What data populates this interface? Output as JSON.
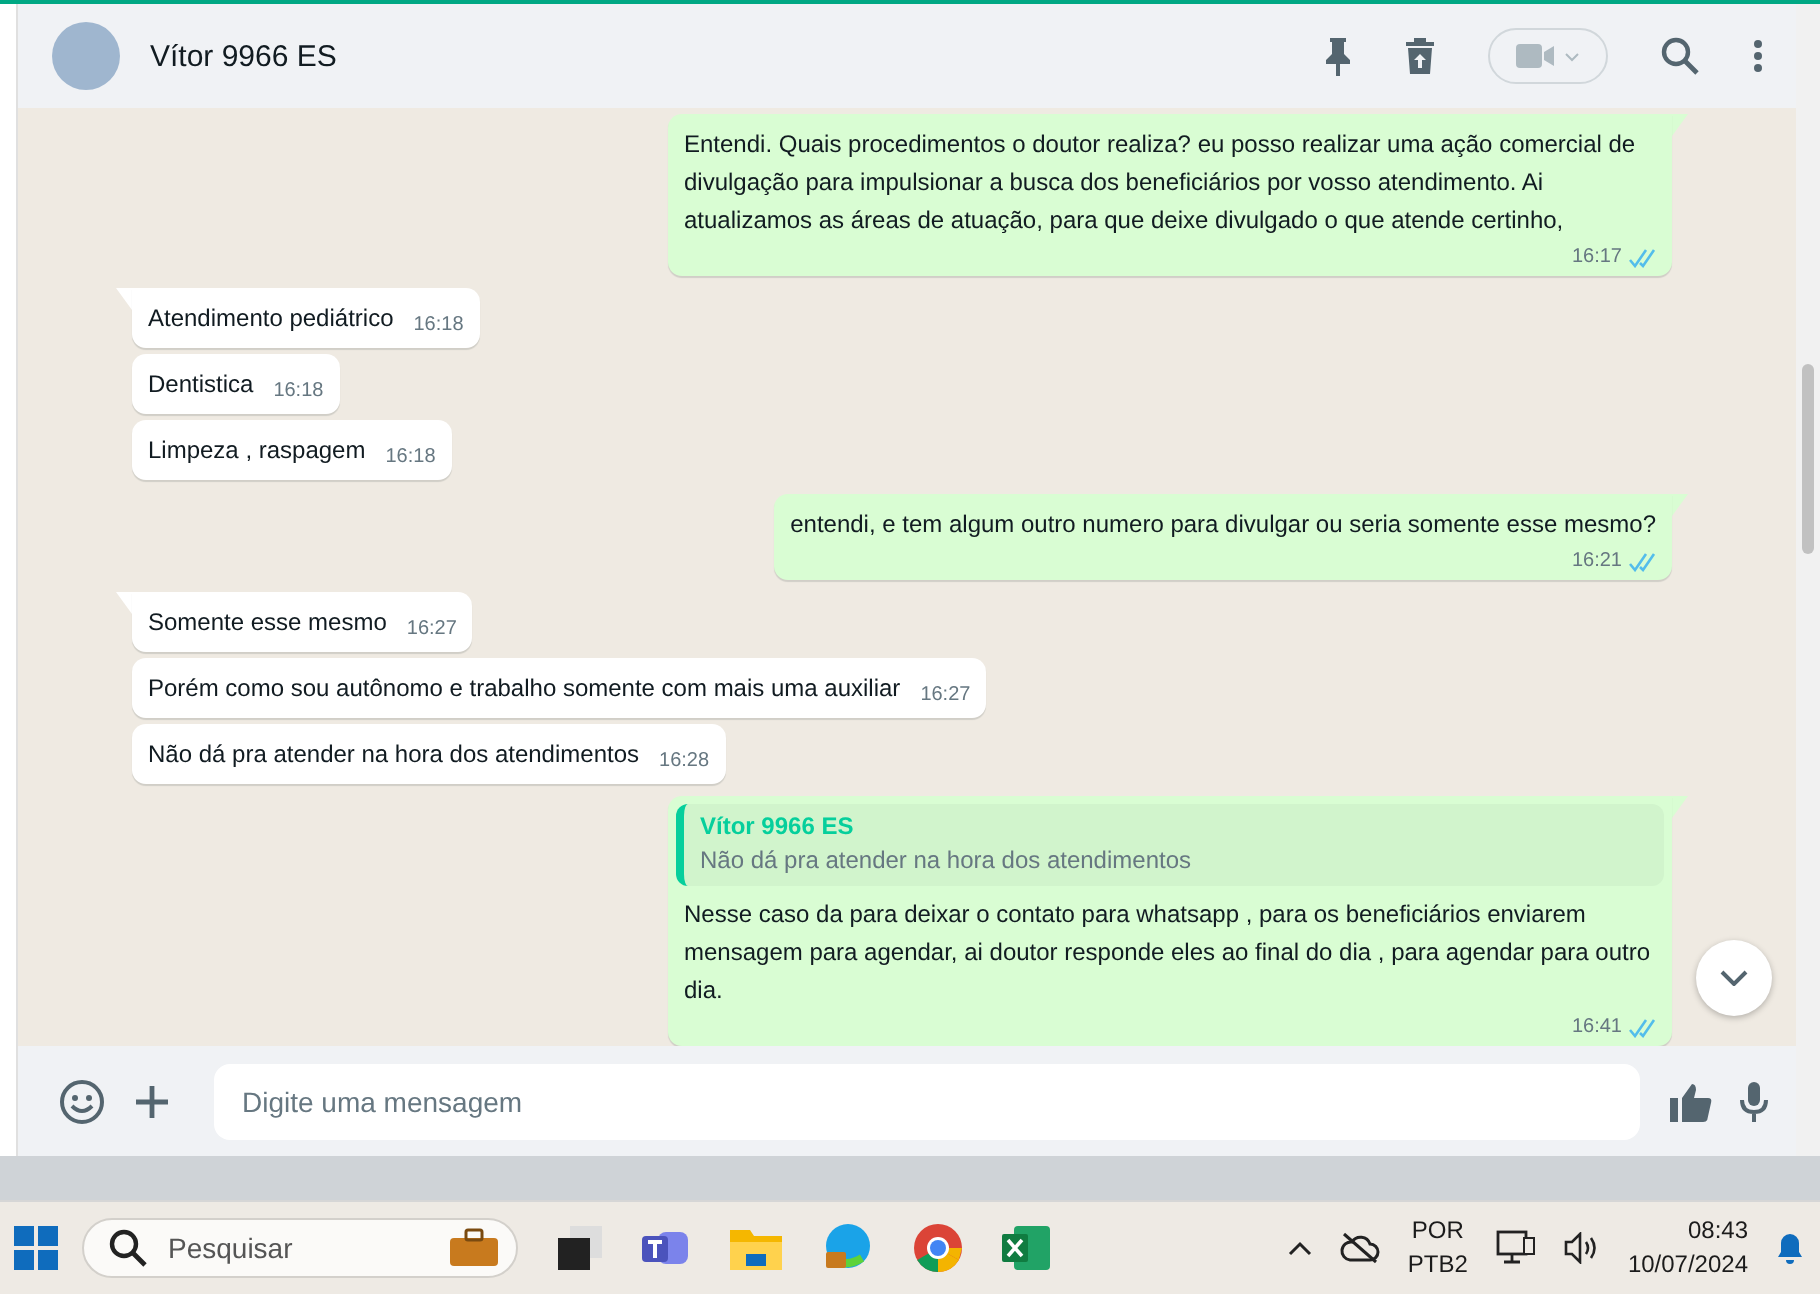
{
  "header": {
    "contact_name": "Vítor 9966 ES"
  },
  "messages": [
    {
      "kind": "outgoing",
      "tail": true,
      "text": "Entendi. Quais procedimentos o doutor realiza? eu posso realizar uma ação comercial de divulgação para impulsionar a busca dos beneficiários por vosso atendimento. Ai atualizamos as áreas de atuação, para que deixe divulgado o que atende certinho,",
      "time": "16:17",
      "read": true
    },
    {
      "kind": "incoming",
      "tail": true,
      "text": "Atendimento pediátrico",
      "time": "16:18"
    },
    {
      "kind": "incoming",
      "tail": false,
      "text": "Dentistica",
      "time": "16:18"
    },
    {
      "kind": "incoming",
      "tail": false,
      "text": "Limpeza , raspagem",
      "time": "16:18"
    },
    {
      "kind": "outgoing",
      "tail": true,
      "text": "entendi, e tem algum outro numero para divulgar ou seria somente esse mesmo?",
      "time": "16:21",
      "read": true
    },
    {
      "kind": "incoming",
      "tail": true,
      "text": "Somente esse mesmo",
      "time": "16:27"
    },
    {
      "kind": "incoming",
      "tail": false,
      "text": "Porém como sou autônomo e trabalho somente com mais uma auxiliar",
      "time": "16:27"
    },
    {
      "kind": "incoming",
      "tail": false,
      "text": "Não dá pra atender na hora dos atendimentos",
      "time": "16:28"
    },
    {
      "kind": "outgoing",
      "tail": true,
      "quote": {
        "author": "Vítor 9966 ES",
        "text": "Não dá pra atender na hora dos atendimentos"
      },
      "text": "Nesse caso da para deixar o contato para whatsapp , para os beneficiários enviarem mensagem para agendar, ai doutor responde eles ao final do dia , para agendar para outro dia.",
      "time": "16:41",
      "read": true
    }
  ],
  "composer": {
    "placeholder": "Digite uma mensagem"
  },
  "taskbar": {
    "search_placeholder": "Pesquisar",
    "language": "POR",
    "layout": "PTB2",
    "time": "08:43",
    "date": "10/07/2024"
  }
}
